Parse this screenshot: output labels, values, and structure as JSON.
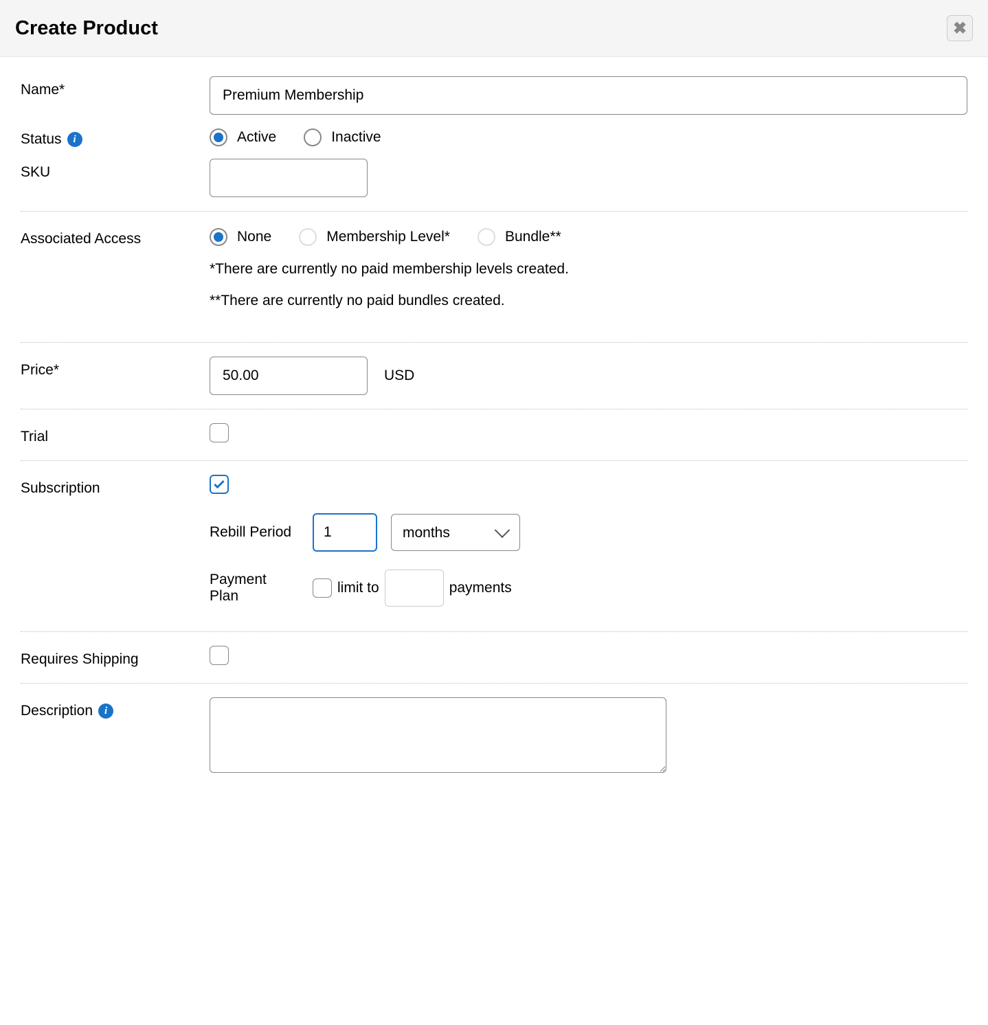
{
  "header": {
    "title": "Create Product"
  },
  "labels": {
    "name": "Name*",
    "status": "Status",
    "sku": "SKU",
    "associated_access": "Associated Access",
    "price": "Price*",
    "trial": "Trial",
    "subscription": "Subscription",
    "rebill_period": "Rebill Period",
    "payment_plan": "Payment Plan",
    "limit_to": "limit to",
    "payments": "payments",
    "requires_shipping": "Requires Shipping",
    "description": "Description"
  },
  "fields": {
    "name": "Premium Membership",
    "sku": "",
    "price": "50.00",
    "currency": "USD",
    "rebill_amount": "1",
    "rebill_unit": "months",
    "payment_limit": "",
    "description": ""
  },
  "status_options": {
    "active": "Active",
    "inactive": "Inactive",
    "selected": "active"
  },
  "access_options": {
    "none": "None",
    "membership": "Membership Level*",
    "bundle": "Bundle**",
    "selected": "none"
  },
  "notes": {
    "membership": "*There are currently no paid membership levels created.",
    "bundle": "**There are currently no paid bundles created."
  },
  "checkboxes": {
    "trial": false,
    "subscription": true,
    "payment_plan_limit": false,
    "requires_shipping": false
  }
}
